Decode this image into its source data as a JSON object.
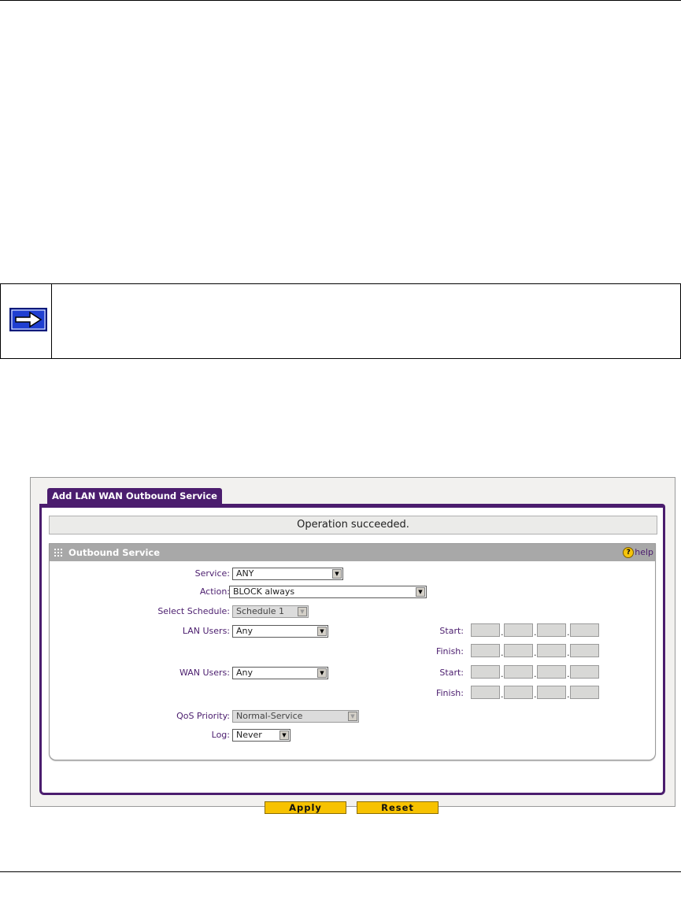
{
  "note": {
    "icon": "right-arrow-icon",
    "icon_color": "#1f3fd1"
  },
  "screen": {
    "tab_title": "Add LAN WAN Outbound Service",
    "status_message": "Operation succeeded.",
    "section": {
      "title": "Outbound Service",
      "help_label": "help"
    },
    "form": {
      "service": {
        "label": "Service:",
        "value": "ANY"
      },
      "action": {
        "label": "Action:",
        "value": "BLOCK always"
      },
      "schedule": {
        "label": "Select Schedule:",
        "value": "Schedule 1"
      },
      "lan_users": {
        "label": "LAN Users:",
        "value": "Any"
      },
      "wan_users": {
        "label": "WAN Users:",
        "value": "Any"
      },
      "qos_priority": {
        "label": "QoS Priority:",
        "value": "Normal-Service"
      },
      "log": {
        "label": "Log:",
        "value": "Never"
      },
      "lan_start_label": "Start:",
      "lan_finish_label": "Finish:",
      "wan_start_label": "Start:",
      "wan_finish_label": "Finish:"
    },
    "buttons": {
      "apply": "Apply",
      "reset": "Reset"
    },
    "colors": {
      "brand": "#4b1d6e",
      "button": "#f7c200",
      "section_header": "#a8a8a8"
    }
  }
}
